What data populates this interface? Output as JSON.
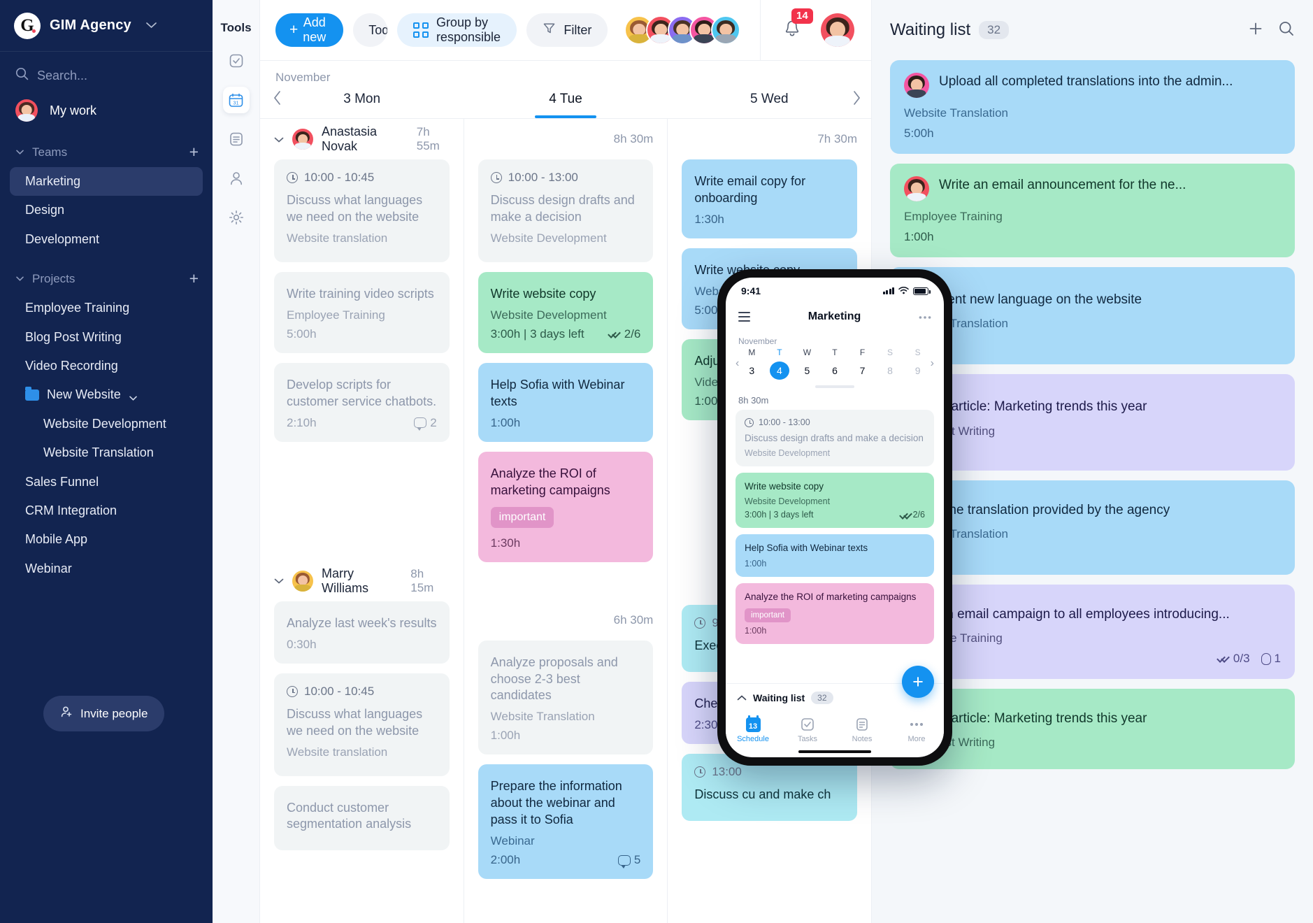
{
  "sidebar": {
    "brand": {
      "name": "GIM Agency",
      "logo_letter": "G"
    },
    "search_placeholder": "Search...",
    "my_work": "My work",
    "teams_title": "Teams",
    "teams": [
      "Marketing",
      "Design",
      "Development"
    ],
    "active_team": "Marketing",
    "projects_title": "Projects",
    "projects": [
      {
        "label": "Employee Training",
        "type": "item"
      },
      {
        "label": "Blog Post Writing",
        "type": "item"
      },
      {
        "label": "Video Recording",
        "type": "item"
      },
      {
        "label": "New Website",
        "type": "folder"
      },
      {
        "label": "Website Development",
        "type": "sub"
      },
      {
        "label": "Website Translation",
        "type": "sub"
      },
      {
        "label": "Sales Funnel",
        "type": "item"
      },
      {
        "label": "CRM Integration",
        "type": "item"
      },
      {
        "label": "Mobile App",
        "type": "item"
      },
      {
        "label": "Webinar",
        "type": "item"
      }
    ],
    "invite_label": "Invite people"
  },
  "rail": {
    "title": "Tools",
    "items": [
      "tasks-icon",
      "calendar-icon",
      "notes-icon",
      "people-icon",
      "settings-icon"
    ],
    "active_index": 1
  },
  "toolbar": {
    "add_label": "Add new",
    "add_plus": "+",
    "today_label": "Today",
    "group_label": "Group by responsible",
    "filter_label": "Filter",
    "notification_count": "14",
    "team_avatar_colors": [
      "#f7c24b",
      "#f2505f",
      "#8b6cf0",
      "#f455a1",
      "#4fc7f0"
    ],
    "my_avatar_color": "#f2505f",
    "accent": "#1492f0"
  },
  "calendar": {
    "month": "November",
    "days": [
      {
        "label": "3 Mon",
        "selected": false,
        "total": "7h 55m"
      },
      {
        "label": "4 Tue",
        "selected": true,
        "total": "8h 30m"
      },
      {
        "label": "5 Wed",
        "selected": false,
        "total": "7h 30m"
      }
    ],
    "groups": [
      {
        "name": "Anastasia Novak",
        "avatar_color": "#f2505f",
        "totals": [
          "7h 55m",
          "8h 30m",
          "7h 30m"
        ]
      },
      {
        "name": "Marry Williams",
        "avatar_color": "#f7c24b",
        "totals": [
          "8h 15m",
          "6h 30m",
          ""
        ]
      }
    ],
    "columns": [
      {
        "day": "3 Mon",
        "group1": [
          {
            "color": "grey",
            "time": "10:00 - 10:45",
            "title": "Discuss what languages we need on the website",
            "project": "Website translation",
            "meta": ""
          },
          {
            "color": "grey",
            "time": "",
            "title": "Write training video scripts",
            "project": "Employee Training",
            "meta": "5:00h"
          },
          {
            "color": "grey",
            "time": "",
            "title": "Develop scripts for customer service chatbots.",
            "project": "",
            "meta": "2:10h",
            "comments": "2"
          }
        ],
        "group2": [
          {
            "color": "grey",
            "time": "",
            "title": "Analyze last week's results",
            "project": "",
            "meta": "0:30h"
          },
          {
            "color": "grey",
            "time": "10:00 - 10:45",
            "title": "Discuss what languages we need on the website",
            "project": "Website translation",
            "meta": ""
          },
          {
            "color": "grey",
            "time": "",
            "title": "Conduct customer segmentation analysis",
            "project": "",
            "meta": ""
          }
        ]
      },
      {
        "day": "4 Tue",
        "group1": [
          {
            "color": "grey",
            "time": "10:00 - 13:00",
            "title": "Discuss design drafts and make a decision",
            "project": "Website Development",
            "meta": ""
          },
          {
            "color": "green",
            "time": "",
            "title": "Write website copy",
            "project": "Website Development",
            "meta": "3:00h | 3 days left",
            "checks": "2/6"
          },
          {
            "color": "blue",
            "time": "",
            "title": "Help Sofia with Webinar texts",
            "project": "",
            "meta": "1:00h"
          },
          {
            "color": "pink",
            "time": "",
            "title": "Analyze the ROI of marketing campaigns",
            "project": "",
            "tag": "important",
            "meta": "1:30h"
          }
        ],
        "group2": [
          {
            "color": "grey",
            "time": "",
            "title": "Analyze proposals and choose 2-3 best candidates",
            "project": "Website Translation",
            "meta": "1:00h"
          },
          {
            "color": "blue",
            "time": "",
            "title": "Prepare the information about the webinar and pass it to Sofia",
            "project": "Webinar",
            "meta": "2:00h",
            "comments": "5"
          }
        ]
      },
      {
        "day": "5 Wed",
        "group1": [
          {
            "color": "blue",
            "time": "",
            "title": "Write email copy for onboarding",
            "project": "",
            "meta": "1:30h"
          },
          {
            "color": "blue",
            "time": "",
            "title": "Write website copy",
            "project": "Website Development",
            "meta": "5:00h | 3 days left"
          },
          {
            "color": "green",
            "time": "",
            "title": "Adjust sc",
            "project": "Video Rec",
            "meta": "1:00h"
          }
        ],
        "group2": [
          {
            "color": "cyan",
            "time": "9:30 -",
            "title": "Executive",
            "project": "",
            "meta": ""
          },
          {
            "color": "purple",
            "time": "",
            "title": "Check res assignmen",
            "project": "",
            "meta": "2:30h | 4 "
          },
          {
            "color": "cyan",
            "time": "13:00",
            "title": "Discuss cu and make ch",
            "project": "",
            "meta": ""
          }
        ]
      }
    ]
  },
  "waiting": {
    "title": "Waiting list",
    "count": "32",
    "cards": [
      {
        "color": "blue",
        "avatar_color": "#f455a1",
        "title": "Upload all completed translations into the admin...",
        "project": "Website Translation",
        "meta": "5:00h",
        "checks": "",
        "attach": ""
      },
      {
        "color": "green",
        "avatar_color": "#f2505f",
        "title": "Write an email announcement for the ne...",
        "project": "Employee Training",
        "meta": "1:00h",
        "checks": "",
        "attach": ""
      },
      {
        "color": "blue",
        "avatar_color": "#8b6cf0",
        "title": "Implement new language on the website",
        "project": "Website Translation",
        "meta": "",
        "checks": "",
        "attach": ""
      },
      {
        "color": "purple",
        "avatar_color": "#f7c24b",
        "title": "Publish article: Marketing trends this year",
        "project": "Blog Post Writing",
        "meta": "",
        "checks": "",
        "attach": ""
      },
      {
        "color": "blue",
        "avatar_color": "#4fc7f0",
        "title": "Check the translation provided by the agency",
        "project": "Website Translation",
        "meta": "",
        "checks": "",
        "attach": ""
      },
      {
        "color": "purple",
        "avatar_color": "#f455a1",
        "title": "Send an email campaign to all employees introducing...",
        "project": "Employee Training",
        "meta": "",
        "checks": "0/3",
        "attach": "1"
      },
      {
        "color": "green",
        "avatar_color": "#f2505f",
        "title": "Publish article: Marketing trends this year",
        "project": "Blog Post Writing",
        "meta": "",
        "checks": "",
        "attach": ""
      }
    ]
  },
  "phone": {
    "status_time": "9:41",
    "title": "Marketing",
    "month": "November",
    "week": [
      {
        "d": "M",
        "n": "3",
        "state": ""
      },
      {
        "d": "T",
        "n": "4",
        "state": "on"
      },
      {
        "d": "W",
        "n": "5",
        "state": ""
      },
      {
        "d": "T",
        "n": "6",
        "state": ""
      },
      {
        "d": "F",
        "n": "7",
        "state": ""
      },
      {
        "d": "S",
        "n": "8",
        "state": "we"
      },
      {
        "d": "S",
        "n": "9",
        "state": "we"
      }
    ],
    "total": "8h 30m",
    "cards": [
      {
        "color": "grey",
        "time": "10:00 - 13:00",
        "title": "Discuss design drafts and make a decision",
        "project": "Website Development",
        "meta": "",
        "checks": ""
      },
      {
        "color": "green",
        "time": "",
        "title": "Write website copy",
        "project": "Website Development",
        "meta": "3:00h | 3 days left",
        "checks": "2/6"
      },
      {
        "color": "blue",
        "time": "",
        "title": "Help Sofia with Webinar texts",
        "project": "",
        "meta": "1:00h",
        "checks": ""
      },
      {
        "color": "pink",
        "time": "",
        "title": "Analyze the ROI of marketing campaigns",
        "project": "",
        "tag": "important",
        "meta": "1:00h",
        "checks": ""
      }
    ],
    "waiting_title": "Waiting list",
    "waiting_count": "32",
    "fab": "+",
    "tabs": [
      {
        "label": "Schedule",
        "icon": "calendar-icon",
        "day": "13",
        "active": true
      },
      {
        "label": "Tasks",
        "icon": "check-icon",
        "active": false
      },
      {
        "label": "Notes",
        "icon": "notes-icon",
        "active": false
      },
      {
        "label": "More",
        "icon": "more-icon",
        "active": false
      }
    ]
  }
}
